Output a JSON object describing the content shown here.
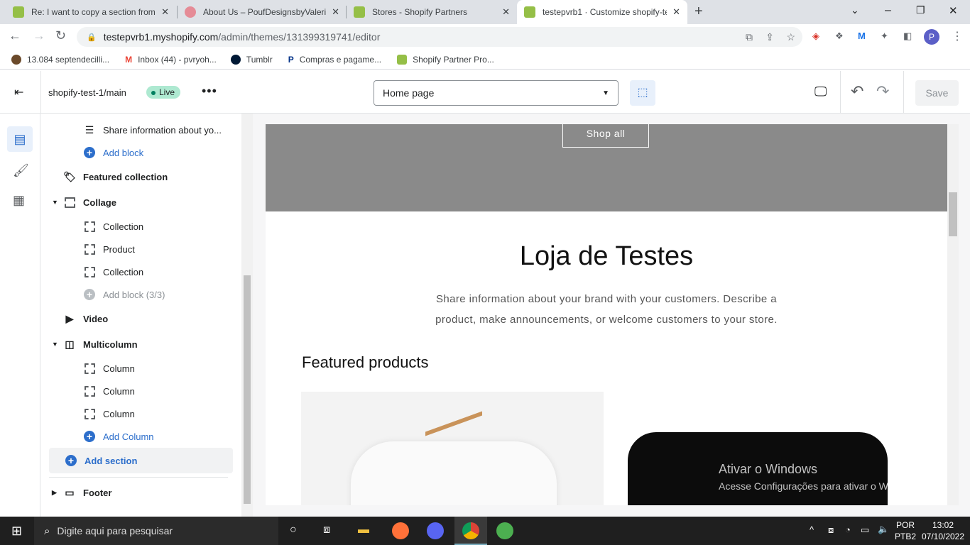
{
  "browser": {
    "tabs": [
      {
        "title": "Re: I want to copy a section from",
        "color": "#95bf47"
      },
      {
        "title": "About Us – PoufDesignsbyValerie",
        "color": "#e58b96"
      },
      {
        "title": "Stores - Shopify Partners",
        "color": "#95bf47"
      },
      {
        "title": "testepvrb1 · Customize shopify-te",
        "color": "#95bf47"
      }
    ],
    "url_host": "testepvrb1.myshopify.com",
    "url_path": "/admin/themes/131399319741/editor",
    "profile_initial": "P",
    "bookmarks": [
      "13.084 septendecilli...",
      "Inbox (44) - pvryoh...",
      "Tumblr",
      "Compras e pagame...",
      "Shopify Partner Pro..."
    ]
  },
  "editor": {
    "theme_name": "shopify-test-1/main",
    "live_badge": "Live",
    "page_select": "Home page",
    "save_label": "Save"
  },
  "sidebar": {
    "items": [
      {
        "label": "Share information about yo...",
        "type": "text-block"
      },
      {
        "label": "Add block",
        "type": "add"
      },
      {
        "label": "Featured collection",
        "type": "section"
      },
      {
        "label": "Collage",
        "type": "section"
      },
      {
        "label": "Collection",
        "type": "block"
      },
      {
        "label": "Product",
        "type": "block"
      },
      {
        "label": "Collection",
        "type": "block"
      },
      {
        "label": "Add block (3/3)",
        "type": "add-disabled"
      },
      {
        "label": "Video",
        "type": "section"
      },
      {
        "label": "Multicolumn",
        "type": "section"
      },
      {
        "label": "Column",
        "type": "block"
      },
      {
        "label": "Column",
        "type": "block"
      },
      {
        "label": "Column",
        "type": "block"
      },
      {
        "label": "Add Column",
        "type": "add"
      },
      {
        "label": "Add section",
        "type": "add-section"
      },
      {
        "label": "Footer",
        "type": "section"
      }
    ]
  },
  "preview": {
    "shop_all": "Shop all",
    "title": "Loja de Testes",
    "description_line1": "Share information about your brand with your customers. Describe a",
    "description_line2": "product, make announcements, or welcome customers to your store.",
    "featured_heading": "Featured products",
    "watermark_title": "Ativar o Windows",
    "watermark_sub": "Acesse Configurações para ativar o Windows."
  },
  "taskbar": {
    "search_placeholder": "Digite aqui para pesquisar",
    "lang1": "POR",
    "lang2": "PTB2",
    "time": "13:02",
    "date": "07/10/2022"
  }
}
